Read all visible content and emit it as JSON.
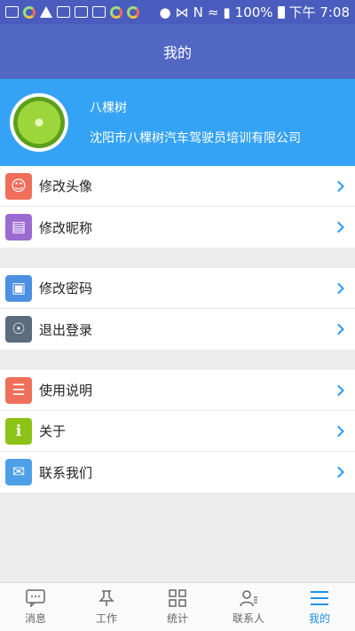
{
  "status_bar": {
    "battery": "100%",
    "time": "下午 7:08",
    "network_label": "N"
  },
  "header": {
    "title": "我的"
  },
  "profile": {
    "name": "八棵树",
    "company": "沈阳市八棵树汽车驾驶员培训有限公司"
  },
  "menu_groups": [
    {
      "items": [
        {
          "label": "修改头像",
          "icon": "avatar-edit-icon",
          "color": "#ef6f5a"
        },
        {
          "label": "修改昵称",
          "icon": "id-card-icon",
          "color": "#9c6bd2"
        }
      ]
    },
    {
      "items": [
        {
          "label": "修改密码",
          "icon": "lock-icon",
          "color": "#4d8fe0"
        },
        {
          "label": "退出登录",
          "icon": "power-icon",
          "color": "#5b6c7d"
        }
      ]
    },
    {
      "items": [
        {
          "label": "使用说明",
          "icon": "book-icon",
          "color": "#ef6f5a"
        },
        {
          "label": "关于",
          "icon": "info-icon",
          "color": "#8cc316",
          "glyph": "i"
        },
        {
          "label": "联系我们",
          "icon": "mail-icon",
          "color": "#4d9fe8"
        }
      ]
    }
  ],
  "bottom_nav": [
    {
      "label": "消息",
      "icon": "message-icon",
      "active": false
    },
    {
      "label": "工作",
      "icon": "pin-icon",
      "active": false
    },
    {
      "label": "统计",
      "icon": "grid-icon",
      "active": false
    },
    {
      "label": "联系人",
      "icon": "contacts-icon",
      "active": false
    },
    {
      "label": "我的",
      "icon": "menu-icon",
      "active": true
    }
  ],
  "colors": {
    "header": "#5267c2",
    "profile_bg": "#35a3f5",
    "accent": "#1e8fe8"
  }
}
